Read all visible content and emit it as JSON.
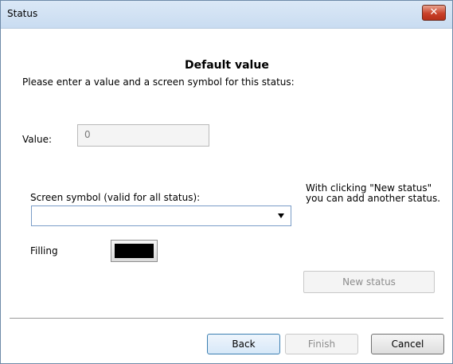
{
  "window": {
    "title": "Status",
    "close_label": "✕"
  },
  "heading": "Default value",
  "subheading": "Please enter a value and a screen symbol for this status:",
  "value_field": {
    "label": "Value:",
    "value": "0"
  },
  "screen_symbol": {
    "label": "Screen symbol (valid for all status):",
    "selected": ""
  },
  "hint": "With clicking \"New status\" you can add another status.",
  "filling": {
    "label": "Filling",
    "color": "#000000"
  },
  "buttons": {
    "new_status": "New status",
    "back": "Back",
    "finish": "Finish",
    "cancel": "Cancel"
  }
}
